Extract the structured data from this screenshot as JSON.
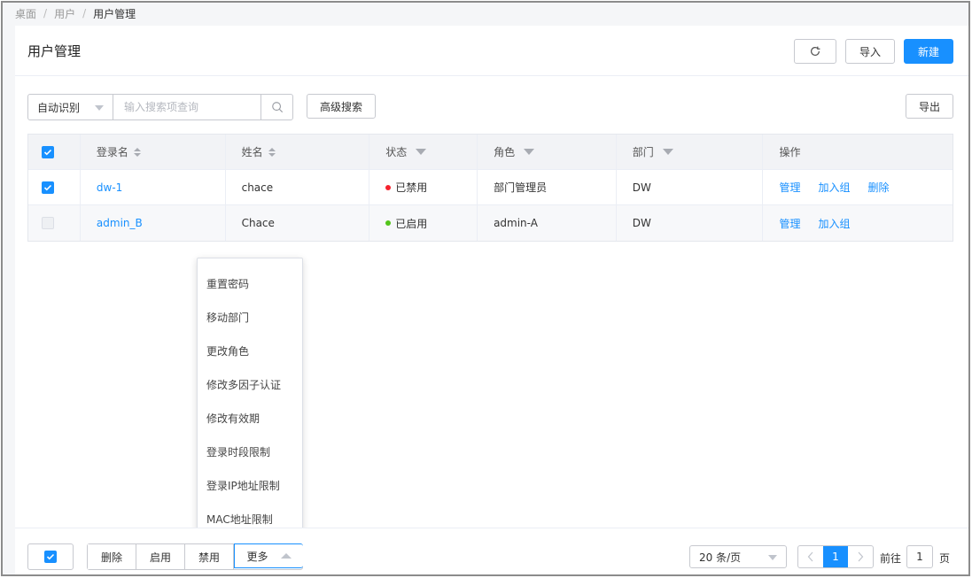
{
  "breadcrumb": [
    "桌面",
    "用户",
    "用户管理"
  ],
  "page_title": "用户管理",
  "header_buttons": {
    "import": "导入",
    "new": "新建"
  },
  "search": {
    "mode": "自动识别",
    "placeholder": "输入搜索项查询",
    "advanced": "高级搜索",
    "export": "导出"
  },
  "table": {
    "columns": [
      "登录名",
      "姓名",
      "状态",
      "角色",
      "部门",
      "操作"
    ],
    "rows": [
      {
        "checked": true,
        "login": "dw-1",
        "name": "chace",
        "status": "已禁用",
        "status_color": "#f5222d",
        "role": "部门管理员",
        "dept": "DW",
        "actions": [
          "管理",
          "加入组",
          "删除"
        ]
      },
      {
        "checked": false,
        "login": "admin_B",
        "name": "Chace",
        "status": "已启用",
        "status_color": "#52c41a",
        "role": "admin-A",
        "dept": "DW",
        "actions": [
          "管理",
          "加入组"
        ]
      }
    ]
  },
  "more_menu": [
    "重置密码",
    "移动部门",
    "更改角色",
    "修改多因子认证",
    "修改有效期",
    "登录时段限制",
    "登录IP地址限制",
    "MAC地址限制"
  ],
  "footer": {
    "batch_buttons": {
      "delete": "删除",
      "enable": "启用",
      "disable": "禁用",
      "more": "更多"
    },
    "page_size": "20 条/页",
    "current_page": "1",
    "goto_label": "前往",
    "goto_value": "1",
    "page_suffix": "页"
  },
  "colors": {
    "primary": "#1890ff"
  }
}
